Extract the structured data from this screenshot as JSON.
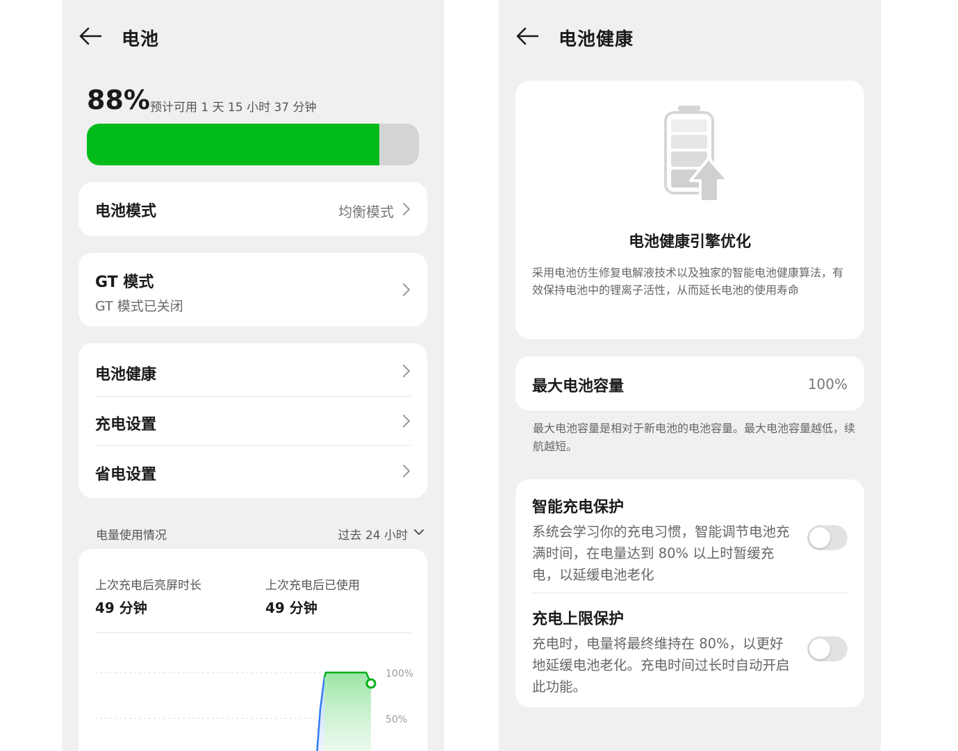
{
  "battery": {
    "title": "电池",
    "percent_text": "88%",
    "level": 0.88,
    "estimate": "预计可用 1 天 15 小时 37 分钟",
    "fill_color": "#00bb1a",
    "mode": {
      "label": "电池模式",
      "value": "均衡模式"
    },
    "gt_mode": {
      "label": "GT 模式",
      "status": "GT 模式已关闭"
    },
    "menu": [
      {
        "label": "电池健康"
      },
      {
        "label": "充电设置"
      },
      {
        "label": "省电设置"
      }
    ],
    "usage": {
      "section_label": "电量使用情况",
      "range": "过去 24 小时",
      "screen_on_label": "上次充电后亮屏时长",
      "screen_on_value": "49 分钟",
      "used_label": "上次充电后已使用",
      "used_value": "49 分钟"
    }
  },
  "chart_data": {
    "type": "area",
    "y_ticks": [
      "100%",
      "50%"
    ],
    "ylim": [
      0,
      100
    ],
    "series": [
      {
        "values": [
          0,
          60,
          95,
          100,
          100,
          100,
          88
        ]
      }
    ],
    "colors": {
      "charging": "#00b01a",
      "discharging": "#2e7bf6"
    },
    "grid": true
  },
  "health": {
    "title": "电池健康",
    "hero_title": "电池健康引擎优化",
    "hero_desc": "采用电池仿生修复电解液技术以及独家的智能电池健康算法，有效保持电池中的锂离子活性，从而延长电池的使用寿命",
    "max_capacity_label": "最大电池容量",
    "max_capacity_value": "100%",
    "max_capacity_note": "最大电池容量是相对于新电池的电池容量。最大电池容量越低，续航越短。",
    "smart_charge": {
      "title": "智能充电保护",
      "desc": "系统会学习你的充电习惯，智能调节电池充满时间，在电量达到 80% 以上时暂缓充电，以延缓电池老化",
      "enabled": false
    },
    "charge_limit": {
      "title": "充电上限保护",
      "desc": "充电时，电量将最终维持在 80%，以更好地延缓电池老化。充电时间过长时自动开启此功能。",
      "enabled": false
    }
  }
}
